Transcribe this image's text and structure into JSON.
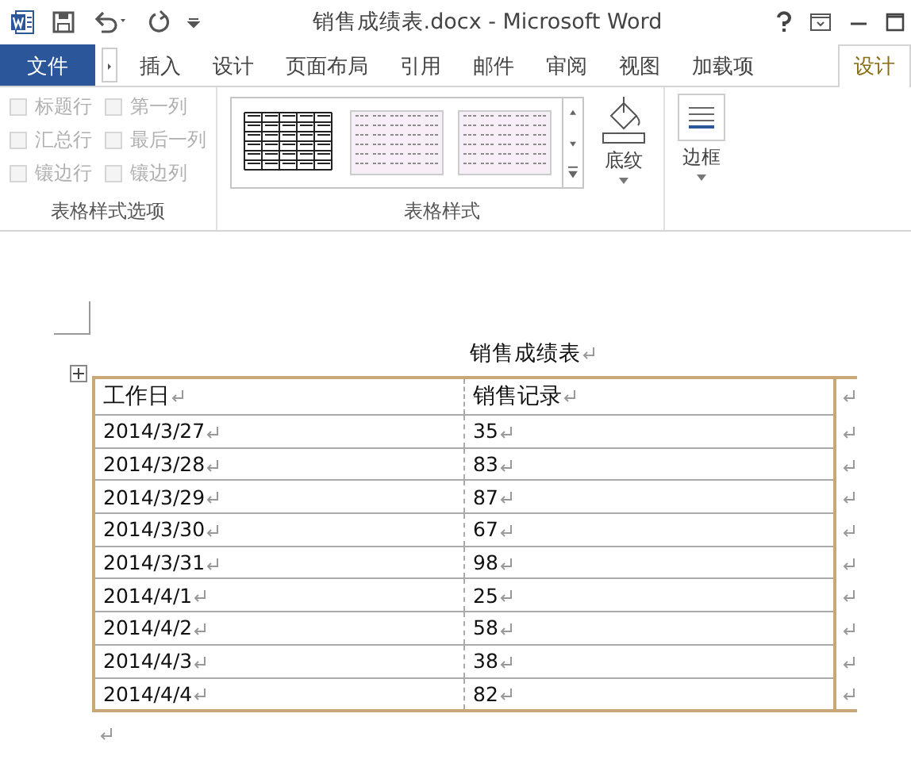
{
  "window": {
    "title": "销售成绩表.docx - Microsoft Word"
  },
  "tabs": [
    {
      "label": "文件",
      "kind": "file",
      "selected": false
    },
    {
      "label": "插入",
      "kind": "tab",
      "selected": false
    },
    {
      "label": "设计",
      "kind": "tab",
      "selected": false
    },
    {
      "label": "页面布局",
      "kind": "tab",
      "selected": false
    },
    {
      "label": "引用",
      "kind": "tab",
      "selected": false
    },
    {
      "label": "邮件",
      "kind": "tab",
      "selected": false
    },
    {
      "label": "审阅",
      "kind": "tab",
      "selected": false
    },
    {
      "label": "视图",
      "kind": "tab",
      "selected": false
    },
    {
      "label": "加载项",
      "kind": "tab",
      "selected": false
    },
    {
      "label": "设计",
      "kind": "contextual",
      "selected": true
    }
  ],
  "ribbon": {
    "options": [
      {
        "label": "标题行",
        "checked": false,
        "disabled": true
      },
      {
        "label": "第一列",
        "checked": false,
        "disabled": true
      },
      {
        "label": "汇总行",
        "checked": false,
        "disabled": true
      },
      {
        "label": "最后一列",
        "checked": false,
        "disabled": true
      },
      {
        "label": "镶边行",
        "checked": false,
        "disabled": true
      },
      {
        "label": "镶边列",
        "checked": false,
        "disabled": true
      }
    ],
    "options_group": "表格样式选项",
    "styles_group": "表格样式",
    "shading": "底纹",
    "borders": "边框"
  },
  "document": {
    "title": "销售成绩表",
    "columns": [
      "工作日",
      "销售记录"
    ],
    "rows": [
      [
        "2014/3/27",
        "35"
      ],
      [
        "2014/3/28",
        "83"
      ],
      [
        "2014/3/29",
        "87"
      ],
      [
        "2014/3/30",
        "67"
      ],
      [
        "2014/3/31",
        "98"
      ],
      [
        "2014/4/1",
        "25"
      ],
      [
        "2014/4/2",
        "58"
      ],
      [
        "2014/4/3",
        "38"
      ],
      [
        "2014/4/4",
        "82"
      ]
    ]
  }
}
